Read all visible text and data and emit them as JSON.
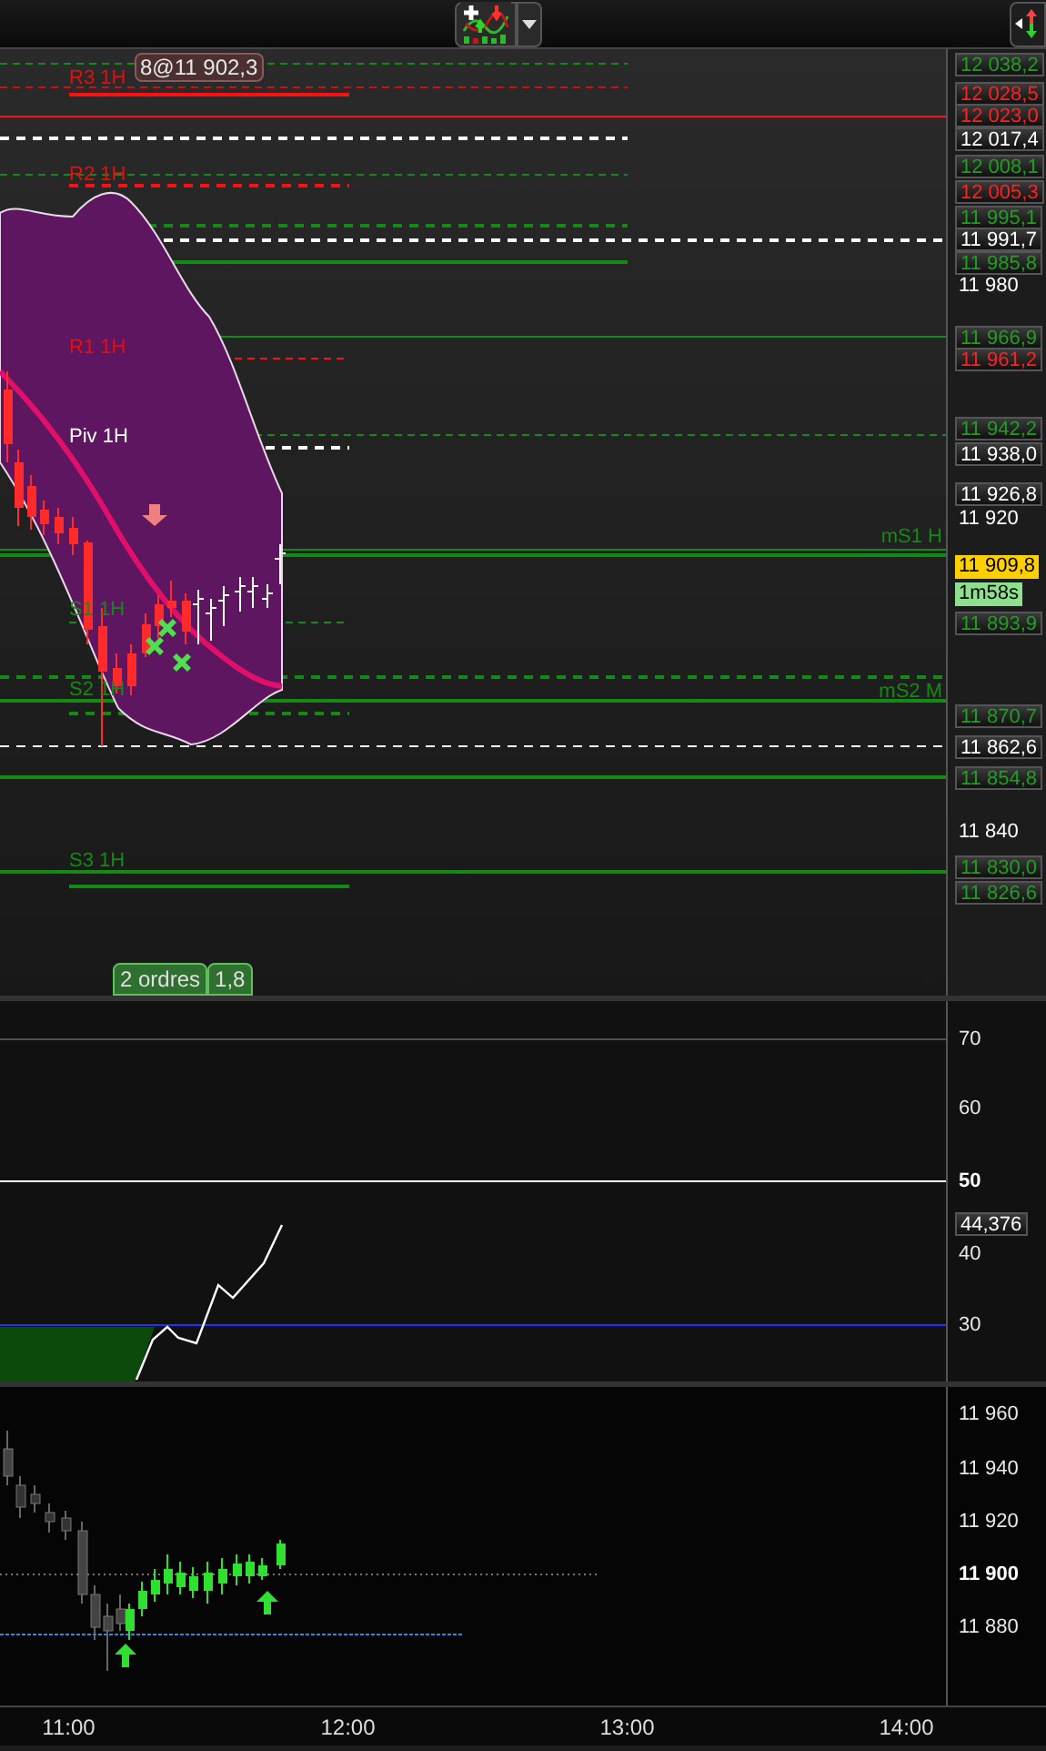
{
  "main_chart": {
    "order_tag": "8@11 902,3",
    "pivot_labels": [
      {
        "text": "R3 1H",
        "color": "#e01010"
      },
      {
        "text": "R2 1H",
        "color": "#e01010"
      },
      {
        "text": "R1 1H",
        "color": "#e01010"
      },
      {
        "text": "Piv 1H",
        "color": "#ffffff"
      },
      {
        "text": "S1 1H",
        "color": "#138a13"
      },
      {
        "text": "S2 1H",
        "color": "#138a13"
      },
      {
        "text": "S3 1H",
        "color": "#138a13"
      },
      {
        "text": "mS1 H",
        "color": "#138a13"
      },
      {
        "text": "mS2 M",
        "color": "#138a13"
      }
    ],
    "orders_tab": {
      "label": "2 ordres",
      "value": "1,8"
    },
    "price_axis": [
      {
        "text": "12 038,2",
        "kind": "box",
        "color": "#1f9f1f"
      },
      {
        "text": "12 028,5",
        "kind": "box",
        "color": "#ff2020"
      },
      {
        "text": "12 023,0",
        "kind": "box",
        "color": "#ff2020"
      },
      {
        "text": "12 017,4",
        "kind": "box",
        "color": "#ffffff"
      },
      {
        "text": "12 008,1",
        "kind": "box",
        "color": "#1f9f1f"
      },
      {
        "text": "12 005,3",
        "kind": "box",
        "color": "#ff2020"
      },
      {
        "text": "11 995,1",
        "kind": "box",
        "color": "#1f9f1f"
      },
      {
        "text": "11 991,7",
        "kind": "box",
        "color": "#ffffff"
      },
      {
        "text": "11 985,8",
        "kind": "box",
        "color": "#1f9f1f"
      },
      {
        "text": "11 980",
        "kind": "tick",
        "color": "#ffffff"
      },
      {
        "text": "11 966,9",
        "kind": "box",
        "color": "#1f9f1f"
      },
      {
        "text": "11 961,2",
        "kind": "box",
        "color": "#ff2020"
      },
      {
        "text": "11 942,2",
        "kind": "box",
        "color": "#1f9f1f"
      },
      {
        "text": "11 938,0",
        "kind": "box",
        "color": "#ffffff"
      },
      {
        "text": "11 926,8",
        "kind": "box",
        "color": "#ffffff"
      },
      {
        "text": "11 920",
        "kind": "tick",
        "color": "#ffffff"
      },
      {
        "text": "11 909,8",
        "kind": "current",
        "color": "#ffd000"
      },
      {
        "text": "1m58s",
        "kind": "timer",
        "color": "#8ee08e"
      },
      {
        "text": "11 893,9",
        "kind": "box",
        "color": "#1f9f1f"
      },
      {
        "text": "11 870,7",
        "kind": "box",
        "color": "#1f9f1f"
      },
      {
        "text": "11 862,6",
        "kind": "box",
        "color": "#ffffff"
      },
      {
        "text": "11 854,8",
        "kind": "box",
        "color": "#1f9f1f"
      },
      {
        "text": "11 840",
        "kind": "tick",
        "color": "#ffffff"
      },
      {
        "text": "11 830,0",
        "kind": "box",
        "color": "#1f9f1f"
      },
      {
        "text": "11 826,6",
        "kind": "box",
        "color": "#1f9f1f"
      }
    ]
  },
  "oscillator": {
    "axis": [
      {
        "text": "70",
        "kind": "tick"
      },
      {
        "text": "60",
        "kind": "tick"
      },
      {
        "text": "50",
        "kind": "major"
      },
      {
        "text": "44,376",
        "kind": "box"
      },
      {
        "text": "40",
        "kind": "tick"
      },
      {
        "text": "30",
        "kind": "tick"
      }
    ]
  },
  "volume_chart": {
    "axis": [
      {
        "text": "11 960",
        "kind": "tick"
      },
      {
        "text": "11 940",
        "kind": "tick"
      },
      {
        "text": "11 920",
        "kind": "tick"
      },
      {
        "text": "11 900",
        "kind": "major"
      },
      {
        "text": "11 880",
        "kind": "tick"
      }
    ]
  },
  "time_axis": [
    "11:00",
    "12:00",
    "13:00",
    "14:00"
  ]
}
